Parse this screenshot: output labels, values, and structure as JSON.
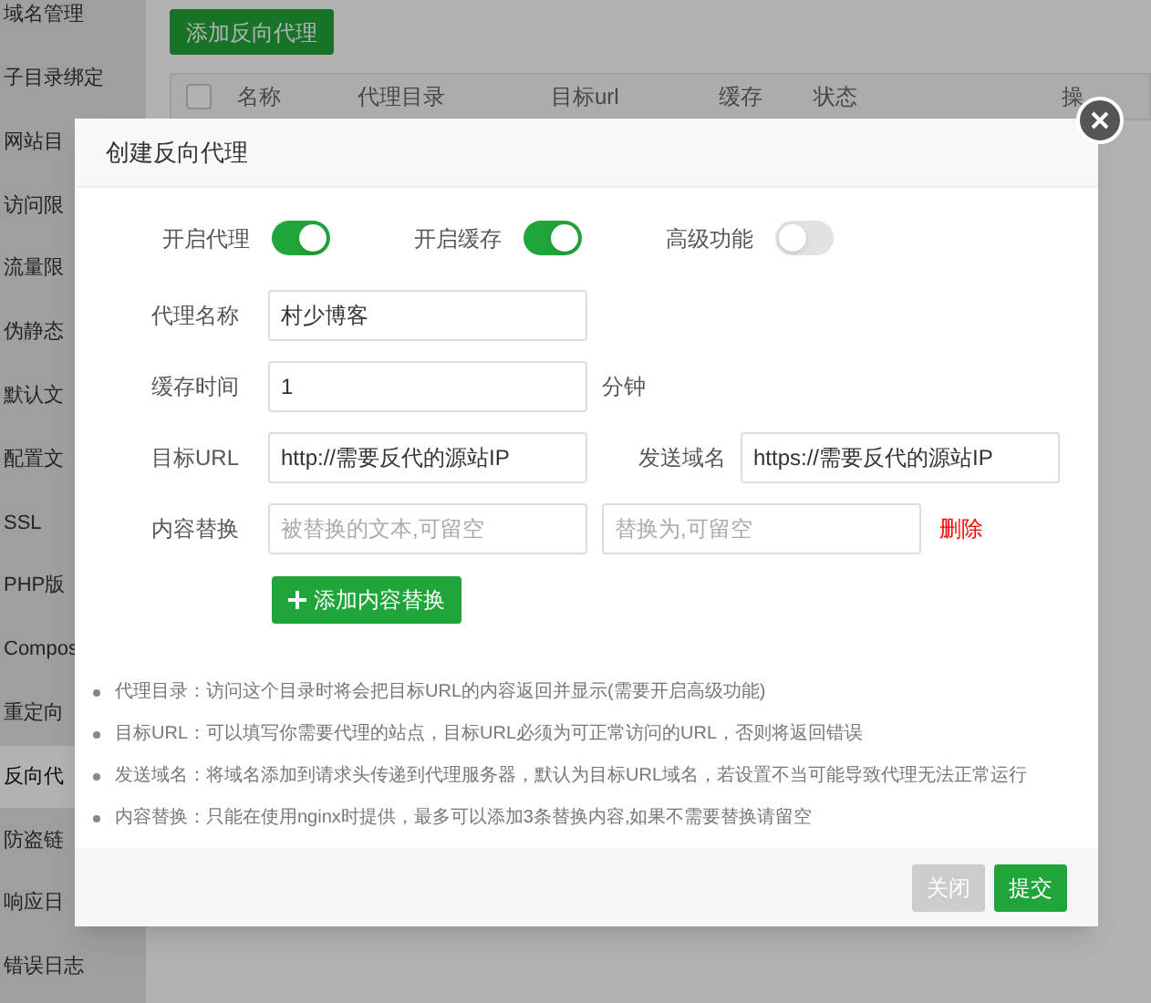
{
  "sidebar": {
    "items": [
      {
        "label": "域名管理",
        "selected": false
      },
      {
        "label": "子目录绑定",
        "selected": false
      },
      {
        "label": "网站目",
        "selected": false
      },
      {
        "label": "访问限",
        "selected": false
      },
      {
        "label": "流量限",
        "selected": false
      },
      {
        "label": "伪静态",
        "selected": false
      },
      {
        "label": "默认文",
        "selected": false
      },
      {
        "label": "配置文",
        "selected": false
      },
      {
        "label": "SSL",
        "selected": false
      },
      {
        "label": "PHP版",
        "selected": false
      },
      {
        "label": "Compos",
        "selected": false
      },
      {
        "label": "重定向",
        "selected": false
      },
      {
        "label": "反向代",
        "selected": true
      },
      {
        "label": "防盗链",
        "selected": false
      },
      {
        "label": "响应日",
        "selected": false
      },
      {
        "label": "错误日志",
        "selected": false
      }
    ]
  },
  "add_button": "添加反向代理",
  "table": {
    "select_all": {
      "checked": false
    },
    "columns": [
      "名称",
      "代理目录",
      "目标url",
      "缓存",
      "状态",
      "操"
    ]
  },
  "dialog": {
    "title": "创建反向代理",
    "switches": [
      {
        "label": "开启代理",
        "on": true
      },
      {
        "label": "开启缓存",
        "on": true
      },
      {
        "label": "高级功能",
        "on": false
      }
    ],
    "rows": [
      {
        "cells": [
          {
            "kind": "label",
            "text": "代理名称"
          },
          {
            "kind": "input",
            "value": "村少博客"
          }
        ]
      },
      {
        "cells": [
          {
            "kind": "label",
            "text": "缓存时间"
          },
          {
            "kind": "input",
            "value": "1"
          },
          {
            "kind": "text",
            "text": "分钟"
          }
        ]
      },
      {
        "cells": [
          {
            "kind": "label",
            "text": "目标URL"
          },
          {
            "kind": "input",
            "value": "http://需要反代的源站IP"
          },
          {
            "kind": "label",
            "text": "发送域名"
          },
          {
            "kind": "input",
            "value": "https://需要反代的源站IP"
          }
        ]
      },
      {
        "cells": [
          {
            "kind": "label",
            "text": "内容替换"
          },
          {
            "kind": "input",
            "placeholder": "被替换的文本,可留空"
          },
          {
            "kind": "input",
            "placeholder": "替换为,可留空"
          },
          {
            "kind": "link",
            "text": "删除"
          }
        ]
      }
    ],
    "add_button": "添加内容替换",
    "notes": [
      "代理目录：访问这个目录时将会把目标URL的内容返回并显示(需要开启高级功能)",
      "目标URL：可以填写你需要代理的站点，目标URL必须为可正常访问的URL，否则将返回错误",
      "发送域名：将域名添加到请求头传递到代理服务器，默认为目标URL域名，若设置不当可能导致代理无法正常运行",
      "内容替换：只能在使用nginx时提供，最多可以添加3条替换内容,如果不需要替换请留空"
    ],
    "buttons": [
      {
        "label": "关闭",
        "kind": "secondary"
      },
      {
        "label": "提交",
        "kind": "primary"
      }
    ]
  }
}
